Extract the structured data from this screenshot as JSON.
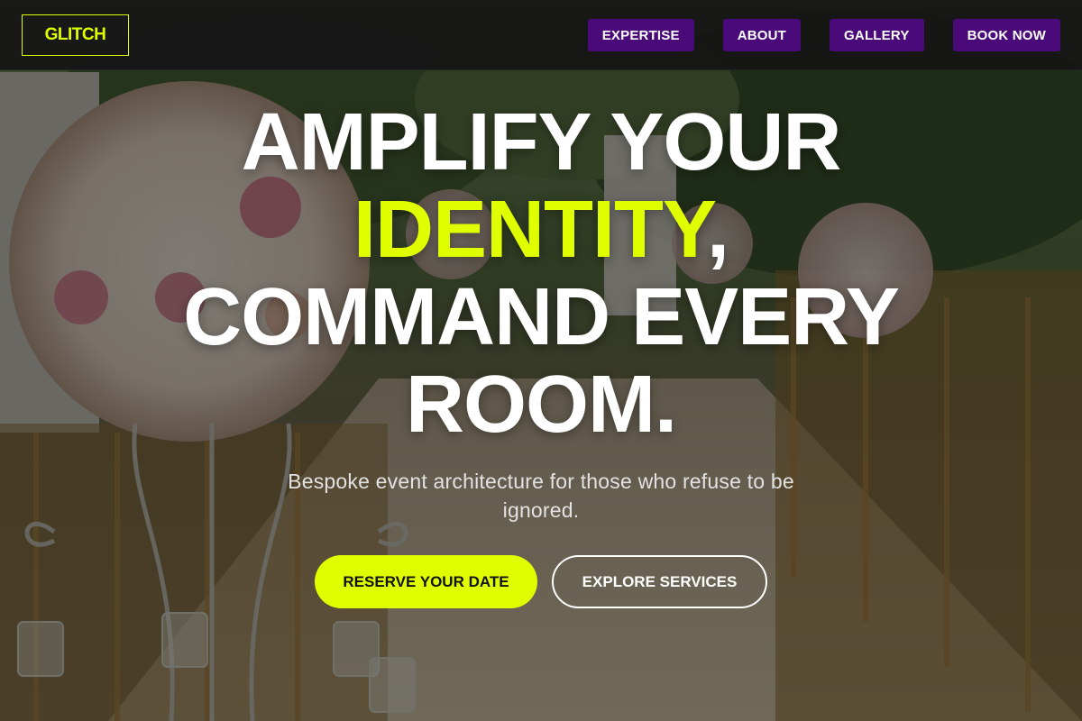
{
  "header": {
    "logo": "GLITCH",
    "nav": [
      {
        "label": "EXPERTISE"
      },
      {
        "label": "ABOUT"
      },
      {
        "label": "GALLERY"
      },
      {
        "label": "BOOK NOW"
      }
    ]
  },
  "hero": {
    "headline_line1": "AMPLIFY YOUR",
    "headline_accent": "IDENTITY",
    "headline_comma": ",",
    "headline_line3": "COMMAND EVERY",
    "headline_line4": "ROOM.",
    "subtitle": "Bespoke event architecture for those who refuse to be ignored.",
    "primary_cta": "RESERVE YOUR DATE",
    "secondary_cta": "EXPLORE SERVICES"
  },
  "colors": {
    "accent": "#dfff00",
    "nav_button": "#4a0a7a",
    "header_bg": "#161616",
    "text": "#ffffff"
  },
  "background": {
    "description_icon": "photo-background"
  }
}
